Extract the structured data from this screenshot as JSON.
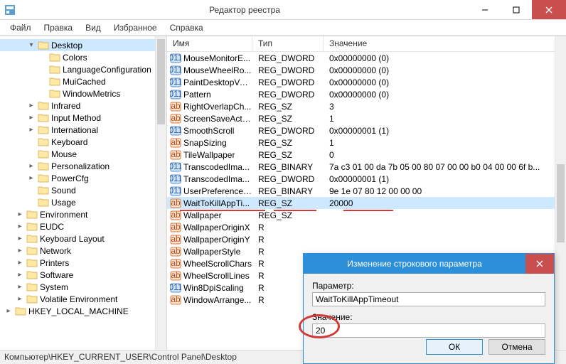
{
  "window": {
    "title": "Редактор реестра"
  },
  "menu": {
    "items": [
      "Файл",
      "Правка",
      "Вид",
      "Избранное",
      "Справка"
    ]
  },
  "tree": [
    {
      "depth": 1,
      "exp": "▾",
      "label": "Desktop",
      "sel": true
    },
    {
      "depth": 2,
      "exp": "",
      "label": "Colors"
    },
    {
      "depth": 2,
      "exp": "",
      "label": "LanguageConfiguration"
    },
    {
      "depth": 2,
      "exp": "",
      "label": "MuiCached"
    },
    {
      "depth": 2,
      "exp": "",
      "label": "WindowMetrics"
    },
    {
      "depth": 1,
      "exp": "▸",
      "label": "Infrared"
    },
    {
      "depth": 1,
      "exp": "▸",
      "label": "Input Method"
    },
    {
      "depth": 1,
      "exp": "▸",
      "label": "International"
    },
    {
      "depth": 1,
      "exp": "",
      "label": "Keyboard"
    },
    {
      "depth": 1,
      "exp": "",
      "label": "Mouse"
    },
    {
      "depth": 1,
      "exp": "▸",
      "label": "Personalization"
    },
    {
      "depth": 1,
      "exp": "▸",
      "label": "PowerCfg"
    },
    {
      "depth": 1,
      "exp": "",
      "label": "Sound"
    },
    {
      "depth": 1,
      "exp": "",
      "label": "Usage"
    },
    {
      "depth": 0,
      "exp": "▸",
      "label": "Environment"
    },
    {
      "depth": 0,
      "exp": "▸",
      "label": "EUDC"
    },
    {
      "depth": 0,
      "exp": "▸",
      "label": "Keyboard Layout"
    },
    {
      "depth": 0,
      "exp": "▸",
      "label": "Network"
    },
    {
      "depth": 0,
      "exp": "▸",
      "label": "Printers"
    },
    {
      "depth": 0,
      "exp": "▸",
      "label": "Software"
    },
    {
      "depth": 0,
      "exp": "▸",
      "label": "System"
    },
    {
      "depth": 0,
      "exp": "▸",
      "label": "Volatile Environment"
    },
    {
      "depth": -1,
      "exp": "▸",
      "label": "HKEY_LOCAL_MACHINE"
    }
  ],
  "list": {
    "headers": [
      "Имя",
      "Тип",
      "Значение"
    ],
    "rows": [
      {
        "icon": "dw",
        "name": "MouseMonitorE...",
        "type": "REG_DWORD",
        "value": "0x00000000 (0)"
      },
      {
        "icon": "dw",
        "name": "MouseWheelRo...",
        "type": "REG_DWORD",
        "value": "0x00000000 (0)"
      },
      {
        "icon": "dw",
        "name": "PaintDesktopVer...",
        "type": "REG_DWORD",
        "value": "0x00000000 (0)"
      },
      {
        "icon": "dw",
        "name": "Pattern",
        "type": "REG_DWORD",
        "value": "0x00000000 (0)"
      },
      {
        "icon": "sz",
        "name": "RightOverlapCh...",
        "type": "REG_SZ",
        "value": "3"
      },
      {
        "icon": "sz",
        "name": "ScreenSaveActive",
        "type": "REG_SZ",
        "value": "1"
      },
      {
        "icon": "dw",
        "name": "SmoothScroll",
        "type": "REG_DWORD",
        "value": "0x00000001 (1)"
      },
      {
        "icon": "sz",
        "name": "SnapSizing",
        "type": "REG_SZ",
        "value": "1"
      },
      {
        "icon": "sz",
        "name": "TileWallpaper",
        "type": "REG_SZ",
        "value": "0"
      },
      {
        "icon": "dw",
        "name": "TranscodedIma...",
        "type": "REG_BINARY",
        "value": "7a c3 01 00 da 7b 05 00 80 07 00 00 b0 04 00 00 6f b..."
      },
      {
        "icon": "dw",
        "name": "TranscodedIma...",
        "type": "REG_DWORD",
        "value": "0x00000001 (1)"
      },
      {
        "icon": "dw",
        "name": "UserPreferences...",
        "type": "REG_BINARY",
        "value": "9e 1e 07 80 12 00 00 00"
      },
      {
        "icon": "sz",
        "name": "WaitToKillAppTi...",
        "type": "REG_SZ",
        "value": "20000",
        "sel": true
      },
      {
        "icon": "sz",
        "name": "Wallpaper",
        "type": "REG_SZ",
        "value": ""
      },
      {
        "icon": "sz",
        "name": "WallpaperOriginX",
        "type": "R",
        "value": ""
      },
      {
        "icon": "sz",
        "name": "WallpaperOriginY",
        "type": "R",
        "value": ""
      },
      {
        "icon": "sz",
        "name": "WallpaperStyle",
        "type": "R",
        "value": ""
      },
      {
        "icon": "sz",
        "name": "WheelScrollChars",
        "type": "R",
        "value": ""
      },
      {
        "icon": "sz",
        "name": "WheelScrollLines",
        "type": "R",
        "value": ""
      },
      {
        "icon": "dw",
        "name": "Win8DpiScaling",
        "type": "R",
        "value": ""
      },
      {
        "icon": "sz",
        "name": "WindowArrange...",
        "type": "R",
        "value": ""
      }
    ]
  },
  "dialog": {
    "title": "Изменение строкового параметра",
    "param_label": "Параметр:",
    "param_value": "WaitToKillAppTimeout",
    "value_label": "Значение:",
    "value_value": "20",
    "ok": "ОК",
    "cancel": "Отмена"
  },
  "status": "Компьютер\\HKEY_CURRENT_USER\\Control Panel\\Desktop"
}
